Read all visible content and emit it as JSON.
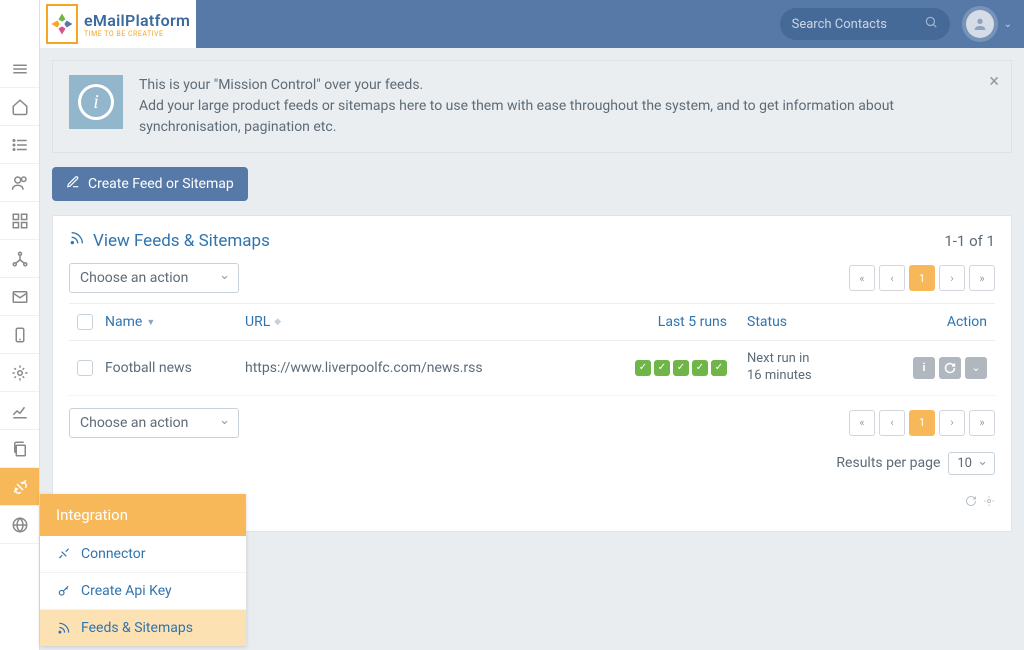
{
  "brand": {
    "name": "eMailPlatform",
    "tagline": "TIME TO BE CREATIVE"
  },
  "search": {
    "placeholder": "Search Contacts"
  },
  "info": {
    "line1": "This is your \"Mission Control\" over your feeds.",
    "line2": "Add your large product feeds or sitemaps here to use them with ease throughout the system, and to get information about synchronisation, pagination etc."
  },
  "buttons": {
    "create_feed": "Create Feed or Sitemap"
  },
  "section": {
    "title": "View Feeds & Sitemaps",
    "count_label": "1-1 of 1",
    "action_select": "Choose an action"
  },
  "columns": {
    "name": "Name",
    "url": "URL",
    "last5": "Last 5 runs",
    "status": "Status",
    "action": "Action"
  },
  "rows": [
    {
      "name": "Football news",
      "url": "https://www.liverpoolfc.com/news.rss",
      "status_line1": "Next run in",
      "status_line2": "16 minutes"
    }
  ],
  "pager": {
    "current": "1"
  },
  "results": {
    "label": "Results per page",
    "value": "10"
  },
  "flyout": {
    "title": "Integration",
    "items": [
      "Connector",
      "Create Api Key",
      "Feeds & Sitemaps"
    ]
  }
}
